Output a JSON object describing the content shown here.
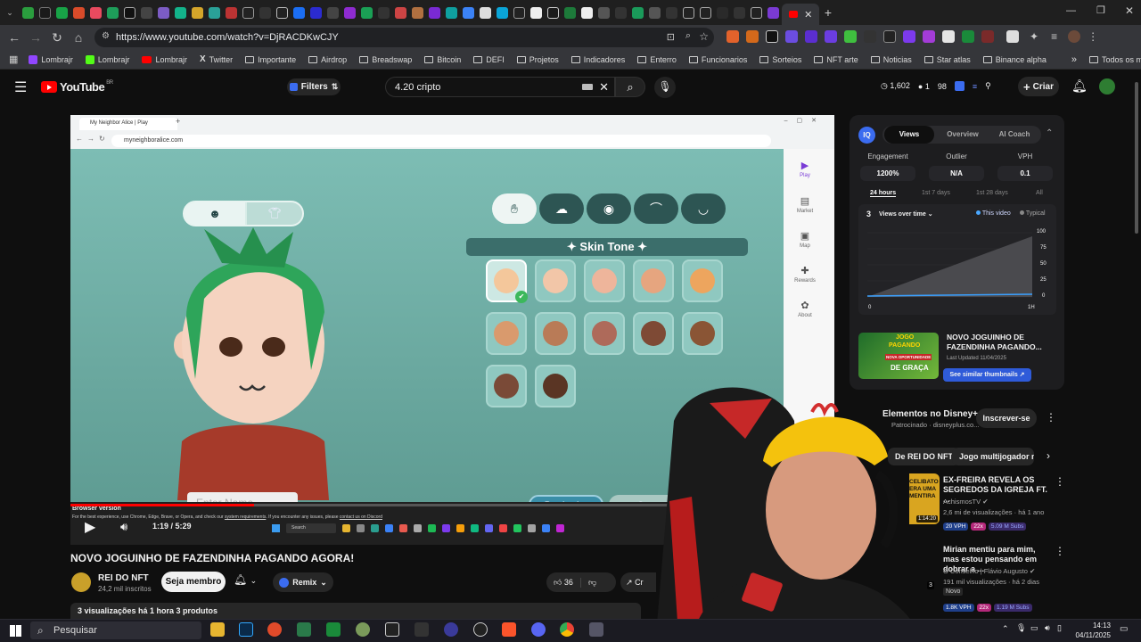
{
  "browser": {
    "url": "https://www.youtube.com/watch?v=DjRACDKwCJY",
    "bookmarks": [
      "Lombrajr",
      "Lombrajr",
      "Lombrajr",
      "Twitter",
      "Importante",
      "Airdrop",
      "Breadswap",
      "Bitcoin",
      "DEFI",
      "Projetos",
      "Indicadores",
      "Enterro",
      "Funcionarios",
      "Sorteios",
      "NFT arte",
      "Noticias",
      "Star atlas",
      "Binance alpha"
    ],
    "all_bookmarks": "Todos os marcadores"
  },
  "youtube": {
    "logo": "YouTube",
    "logo_region": "BR",
    "filters_label": "Filters",
    "search_value": "4.20 cripto",
    "stats": {
      "views": "1,602",
      "a": "1",
      "b": "98"
    },
    "create_label": "Criar"
  },
  "video": {
    "inner_tab": "My Neighbor Alice | Play",
    "inner_url": "myneighboralice.com",
    "sidebar": [
      "Play",
      "Market",
      "Map",
      "Rewards",
      "About"
    ],
    "skin_tone_title": "✦ Skin Tone ✦",
    "name_placeholder": "Enter Name...",
    "randomize_label": "Randomize",
    "save_label": "Save",
    "browser_version": "Browser version",
    "browser_notice_a": "For the best experience, use Chrome, Edge, Brave, or Opera, and check our",
    "browser_notice_link": "system requirements",
    "browser_notice_b": ". If you encounter any issues, please",
    "browser_notice_contact": "contact us on Discord",
    "inner_search": "Search",
    "time": "1:19 / 5:29",
    "progress": 0.24,
    "swatch_colors": [
      "#f4c79b",
      "#f2c6a8",
      "#eeb59b",
      "#e6a57f",
      "#eda55e",
      "#d99a6d",
      "#b97b57",
      "#ae6a5a",
      "#7e4a35",
      "#8a5535",
      "#7a4a37",
      "#5a3524"
    ]
  },
  "below": {
    "title": "NOVO JOGUINHO DE FAZENDINHA PAGANDO AGORA!",
    "channel": "REI DO NFT",
    "subs": "24,2 mil inscritos",
    "join": "Seja membro",
    "remix": "Remix",
    "likes": "36",
    "share_partial": "Cr",
    "meta": "3 visualizações  há 1 hora  3 produtos"
  },
  "panel": {
    "logo": "IQ",
    "tabs": [
      "Views",
      "Overview",
      "AI Coach"
    ],
    "metrics": [
      {
        "label": "Engagement",
        "value": "1200%"
      },
      {
        "label": "Outlier",
        "value": "N/A"
      },
      {
        "label": "VPH",
        "value": "0.1"
      }
    ],
    "ranges": [
      "24 hours",
      "1st 7 days",
      "1st 28 days",
      "All"
    ],
    "chart_count": "3",
    "chart_dropdown": "Views over time",
    "legend_this": "This video",
    "legend_typical": "Typical",
    "y_ticks": [
      "100",
      "75",
      "50",
      "25",
      "0"
    ],
    "x_start": "0",
    "x_end": "1H",
    "similar_title": "NOVO JOGUINHO DE FAZENDINHA PAGANDO...",
    "similar_date": "Last Updated 11/04/2025",
    "similar_btn": "See similar thumbnails ↗",
    "thumb_text": [
      "JOGO",
      "PAGANDO",
      "NOVA OPORTUNIDADE",
      "DE GRAÇA"
    ]
  },
  "ad": {
    "title": "Elementos no Disney+",
    "sponsor": "Patrocinado · disneyplus.co...",
    "subscribe": "Inscrever-se"
  },
  "chips": [
    "De REI DO NFT",
    "Jogo multijogador ma"
  ],
  "recs": [
    {
      "title": "EX-FREIRA REVELA OS SEGREDOS DA IGREJA FT. ...",
      "channel": "AchismosTV",
      "stats": "2,6 mi de visualizações · há 1 ano",
      "vph": "20 VPH",
      "mult": "22x",
      "subs": "5.09 M Subs",
      "duration": "1:14:20",
      "thumb_text": "CELIBATO ERA UMA MENTIRA"
    },
    {
      "title": "Mirian mentiu para mim, mas estou pensando em dobrar a ...",
      "channel": "O Conselho | Flávio Augusto",
      "stats": "191 mil visualizações · há 2 dias",
      "tag": "Novo",
      "vph": "1.8K VPH",
      "mult": "22x",
      "subs": "1.19 M Subs",
      "duration": "3"
    }
  ],
  "taskbar": {
    "search": "Pesquisar",
    "time": "14:13",
    "date": "04/11/2025"
  }
}
